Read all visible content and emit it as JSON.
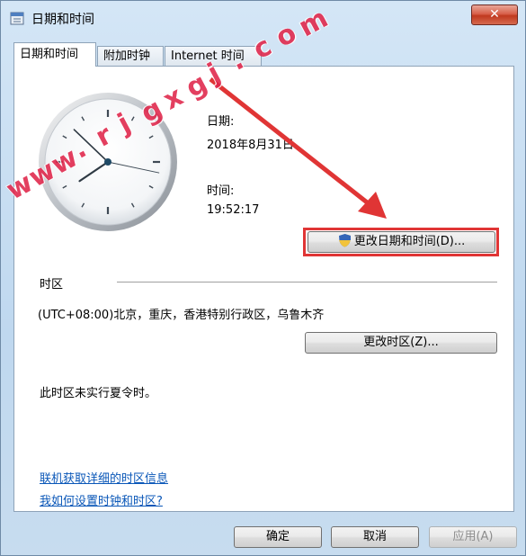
{
  "window": {
    "title": "日期和时间",
    "close_label": "✕"
  },
  "tabs": [
    {
      "label": "日期和时间",
      "active": true
    },
    {
      "label": "附加时钟",
      "active": false
    },
    {
      "label": "Internet 时间",
      "active": false
    }
  ],
  "datetime": {
    "date_label": "日期:",
    "date_value": "2018年8月31日",
    "time_label": "时间:",
    "time_value": "19:52:17",
    "change_button": "更改日期和时间(D)..."
  },
  "clock": {
    "hour": 19,
    "minute": 52,
    "second": 17
  },
  "timezone": {
    "section_title": "时区",
    "value": "(UTC+08:00)北京，重庆，香港特别行政区，乌鲁木齐",
    "change_button": "更改时区(Z)...",
    "dst_note": "此时区未实行夏令时。"
  },
  "links": [
    "联机获取详细的时区信息",
    "我如何设置时钟和时区?"
  ],
  "footer": {
    "ok": "确定",
    "cancel": "取消",
    "apply": "应用(A)"
  },
  "watermark": {
    "text": "www.rjgxgj.com"
  },
  "colors": {
    "highlight": "#e03535",
    "link": "#0a57b8",
    "watermark": "#e0254a"
  }
}
